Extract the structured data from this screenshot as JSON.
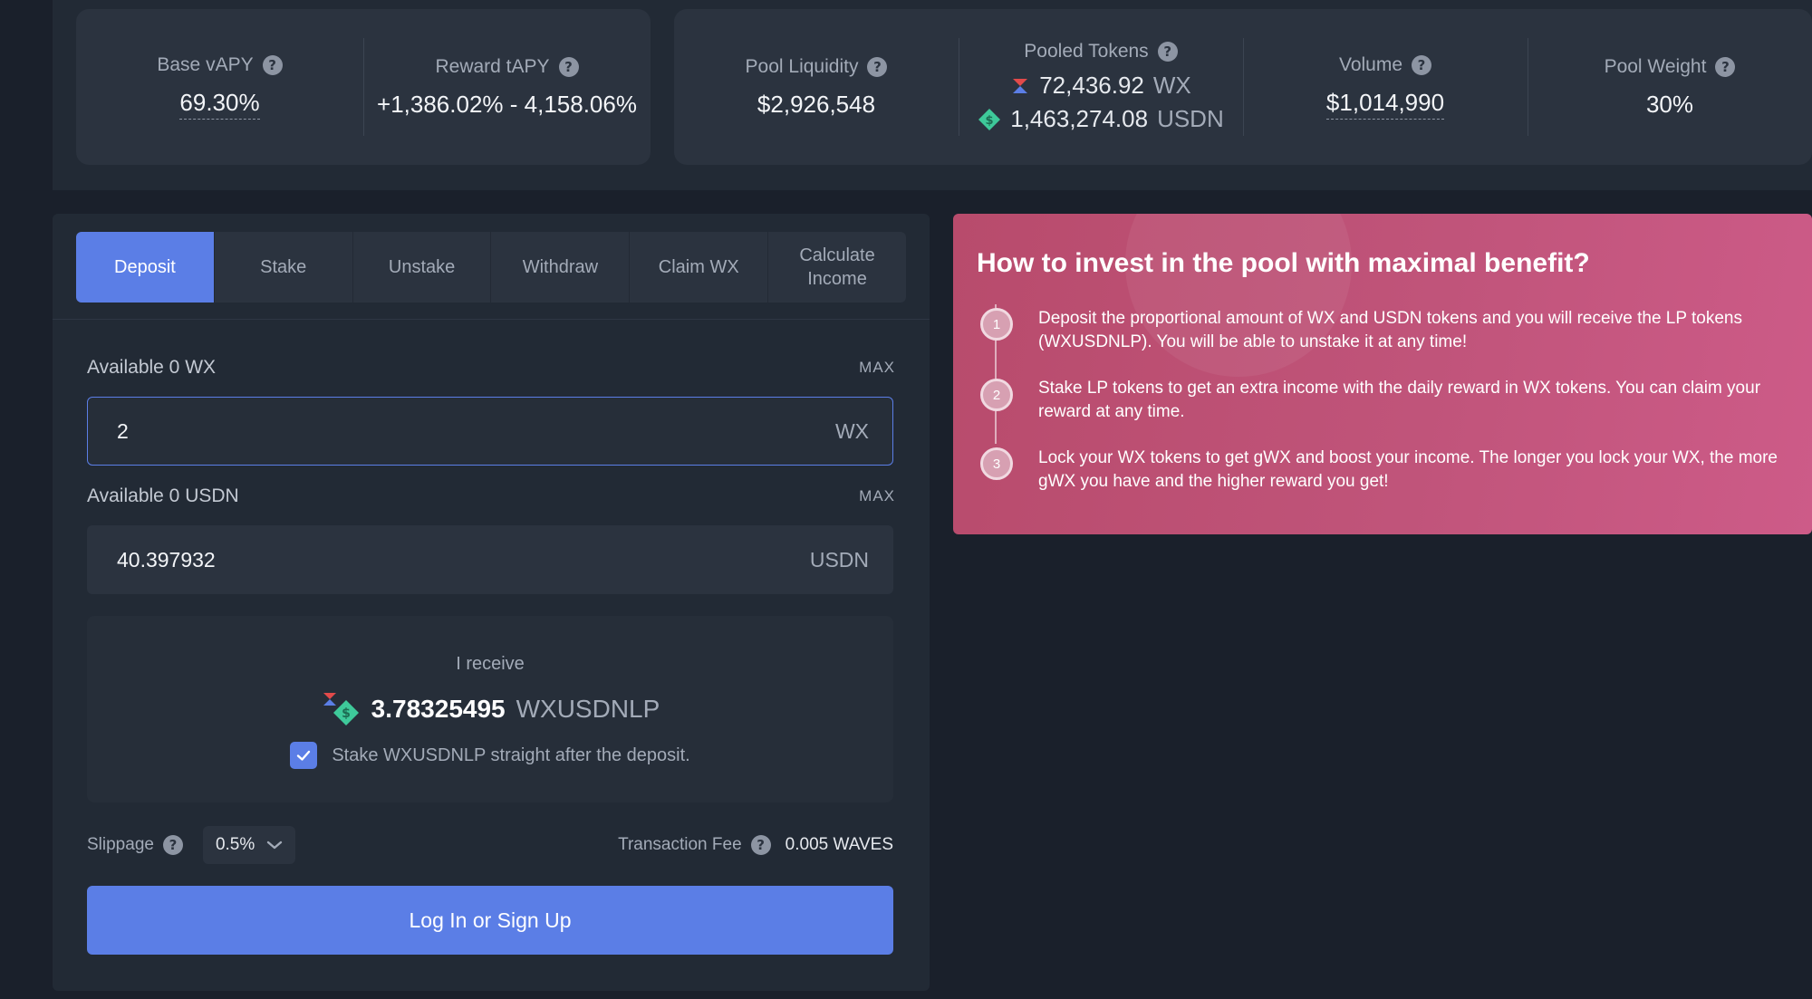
{
  "stats": {
    "base_vapy_label": "Base vAPY",
    "base_vapy_value": "69.30%",
    "reward_tapy_label": "Reward tAPY",
    "reward_tapy_value": "+1,386.02% - 4,158.06%",
    "pool_liquidity_label": "Pool Liquidity",
    "pool_liquidity_value": "$2,926,548",
    "pooled_tokens_label": "Pooled Tokens",
    "pooled_wx_amount": "72,436.92",
    "pooled_wx_unit": "WX",
    "pooled_usdn_amount": "1,463,274.08",
    "pooled_usdn_unit": "USDN",
    "volume_label": "Volume",
    "volume_value": "$1,014,990",
    "pool_weight_label": "Pool Weight",
    "pool_weight_value": "30%",
    "help_glyph": "?"
  },
  "tabs": [
    {
      "label": "Deposit",
      "active": true
    },
    {
      "label": "Stake"
    },
    {
      "label": "Unstake"
    },
    {
      "label": "Withdraw"
    },
    {
      "label": "Claim WX"
    },
    {
      "label": "Calculate Income"
    }
  ],
  "deposit": {
    "wx_available_label": "Available 0 WX",
    "usdn_available_label": "Available 0 USDN",
    "max_label": "MAX",
    "wx_value": "2",
    "wx_unit": "WX",
    "usdn_value": "40.397932",
    "usdn_unit": "USDN",
    "receive_label": "I receive",
    "receive_amount": "3.78325495",
    "receive_unit": "WXUSDNLP",
    "stake_checkbox_label": "Stake WXUSDNLP straight after the deposit.",
    "stake_checked": true,
    "slippage_label": "Slippage",
    "slippage_value": "0.5%",
    "fee_label": "Transaction Fee",
    "fee_value": "0.005 WAVES",
    "login_button": "Log In or Sign Up"
  },
  "info": {
    "title": "How to invest in the pool with maximal benefit?",
    "steps": [
      {
        "num": "1",
        "text": "Deposit the proportional amount of WX and USDN tokens and you will receive the LP tokens (WXUSDNLP). You will be able to unstake it at any time!"
      },
      {
        "num": "2",
        "text": "Stake LP tokens to get an extra income with the daily reward in WX tokens. You can claim your reward at any time."
      },
      {
        "num": "3",
        "text": "Lock your WX tokens to get gWX and boost your income. The longer you lock your WX, the more gWX you have and the higher reward you get!"
      }
    ]
  },
  "colors": {
    "accent": "#5b7ee6",
    "info_card": "#c0547a",
    "wx_token_red": "#e24a4a",
    "wx_token_blue": "#5b7ee6",
    "usdn_token_green": "#3ec99a"
  },
  "icons": {
    "help": "question-circle-icon",
    "wx_token": "wx-token-icon",
    "usdn_token": "usdn-token-icon",
    "lp_token": "lp-token-icon",
    "checkmark": "checkmark-icon",
    "dropdown": "chevron-down-icon"
  }
}
